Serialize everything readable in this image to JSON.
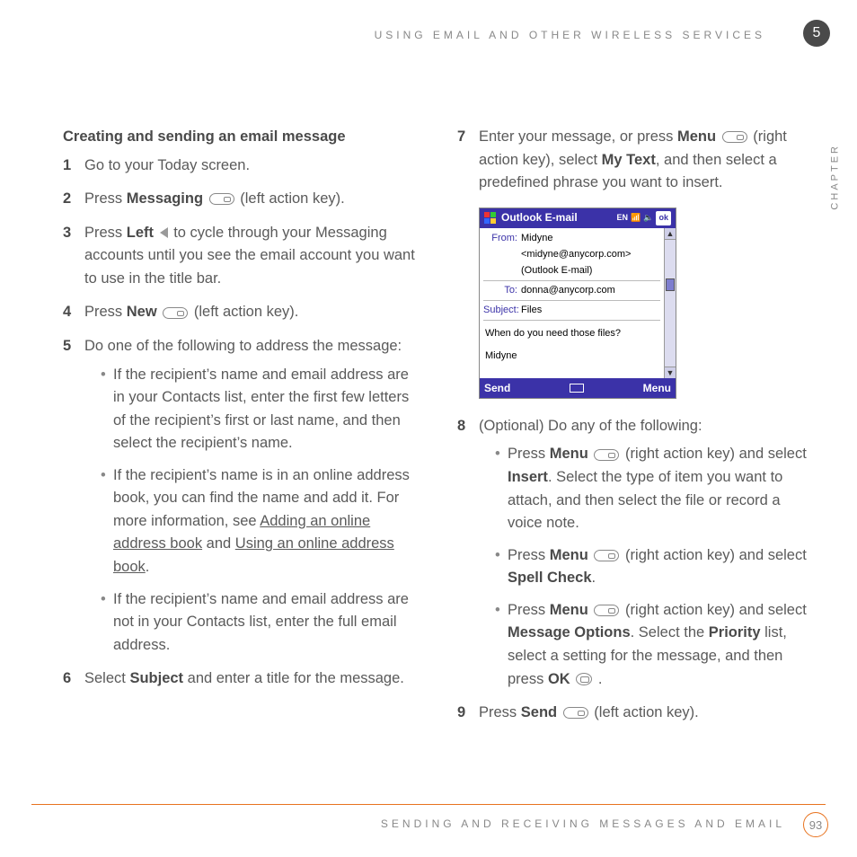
{
  "header": {
    "running_head": "USING EMAIL AND OTHER WIRELESS SERVICES"
  },
  "chapter": {
    "number": "5",
    "label": "CHAPTER"
  },
  "section_title": "Creating and sending an email message",
  "left": {
    "step1": "Go to your Today screen.",
    "step2_a": "Press ",
    "step2_b": "Messaging",
    "step2_c": " (left action key).",
    "step3_a": "Press ",
    "step3_b": "Left",
    "step3_c": " to cycle through your Messaging accounts until you see the email account you want to use in the title bar.",
    "step4_a": "Press ",
    "step4_b": "New",
    "step4_c": " (left action key).",
    "step5": "Do one of the following to address the message:",
    "b1": "If the recipient’s name and email address are in your Contacts list, enter the first few letters of the recipient’s first or last name, and then select the recipient’s name.",
    "b2_a": "If the recipient’s name is in an online address book, you can find the name and add it. For more information, see ",
    "b2_link1": "Adding an online address book",
    "b2_mid": " and ",
    "b2_link2": "Using an online address book",
    "b2_end": ".",
    "b3": "If the recipient’s name and email address are not in your Contacts list, enter the full email address.",
    "step6_a": "Select ",
    "step6_b": "Subject",
    "step6_c": " and enter a title for the message."
  },
  "right": {
    "step7_a": "Enter your message, or press ",
    "step7_b": "Menu",
    "step7_c": " (right action key), select ",
    "step7_d": "My Text",
    "step7_e": ", and then select a predefined phrase you want to insert.",
    "step8": "(Optional) Do any of the following:",
    "r1_a": "Press ",
    "r1_b": "Menu",
    "r1_c": " (right action key) and select ",
    "r1_d": "Insert",
    "r1_e": ". Select the type of item you want to attach, and then select the file or record a voice note.",
    "r2_a": "Press ",
    "r2_b": "Menu",
    "r2_c": " (right action key) and select ",
    "r2_d": "Spell Check",
    "r2_e": ".",
    "r3_a": "Press ",
    "r3_b": "Menu",
    "r3_c": " (right action key) and select ",
    "r3_d": "Message Options",
    "r3_e": ". Select the ",
    "r3_f": "Priority",
    "r3_g": " list, select a setting for the message, and then press ",
    "r3_h": "OK",
    "r3_i": " .",
    "step9_a": "Press ",
    "step9_b": "Send",
    "step9_c": " (left action key)."
  },
  "phone": {
    "title": "Outlook E-mail",
    "status": "EN",
    "ok": "ok",
    "from_label": "From:",
    "from_name": "Midyne",
    "from_email": "<midyne@anycorp.com>",
    "from_account": "(Outlook E-mail)",
    "to_label": "To:",
    "to_value": "donna@anycorp.com",
    "subject_label": "Subject:",
    "subject_value": "Files",
    "body_line1": "When do you need those files?",
    "body_line2": "Midyne",
    "footer_left": "Send",
    "footer_right": "Menu"
  },
  "footer": {
    "text": "SENDING AND RECEIVING MESSAGES AND EMAIL",
    "page": "93"
  }
}
